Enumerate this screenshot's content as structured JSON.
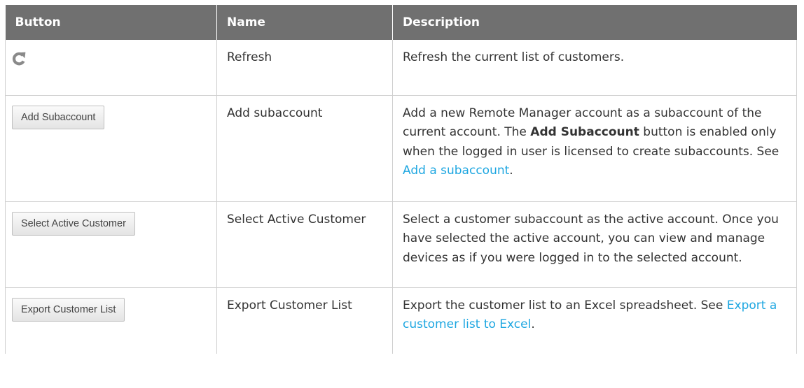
{
  "headers": {
    "button": "Button",
    "name": "Name",
    "description": "Description"
  },
  "rows": [
    {
      "button_icon": "refresh-icon",
      "name": "Refresh",
      "description": "Refresh the current list of customers."
    },
    {
      "button_label": "Add Subaccount",
      "name": "Add subaccount",
      "desc_part1": "Add a new Remote Manager account as a subaccount of the current account. The ",
      "desc_bold": "Add Subaccount",
      "desc_part2": " button is enabled only when the logged in user is licensed to create subaccounts. See ",
      "link": "Add a subaccount",
      "desc_end": "."
    },
    {
      "button_label": "Select Active Customer",
      "name": "Select Active Customer",
      "description": "Select a customer subaccount as the active account. Once you have selected the active account, you can view and manage devices as if you were logged in to the selected account."
    },
    {
      "button_label": "Export Customer List",
      "name": "Export Customer List",
      "desc_part1": "Export the customer list to an Excel spreadsheet. See ",
      "link": "Export a customer list to Excel",
      "desc_end": "."
    }
  ],
  "colors": {
    "header_bg": "#707070",
    "link": "#1fa7e1",
    "border": "#cfcfcf"
  }
}
